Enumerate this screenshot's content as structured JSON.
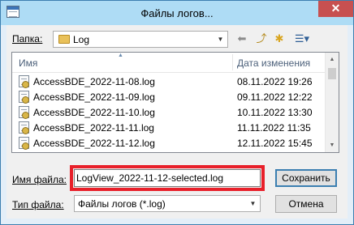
{
  "window": {
    "title": "Файлы логов...",
    "close_glyph": "✕"
  },
  "folder": {
    "label": "Папка:",
    "value": "Log"
  },
  "toolbar": {
    "back_glyph": "⬅",
    "up_glyph": "⤴",
    "new_folder_glyph": "✱",
    "view_glyph": "☰▾"
  },
  "file_list": {
    "columns": [
      "Имя",
      "Дата изменения"
    ],
    "sort_glyph": "▲",
    "rows": [
      {
        "name": "AccessBDE_2022-11-08.log",
        "date": "08.11.2022 19:26"
      },
      {
        "name": "AccessBDE_2022-11-09.log",
        "date": "09.11.2022 12:22"
      },
      {
        "name": "AccessBDE_2022-11-10.log",
        "date": "10.11.2022 13:30"
      },
      {
        "name": "AccessBDE_2022-11-11.log",
        "date": "11.11.2022 11:35"
      },
      {
        "name": "AccessBDE_2022-11-12.log",
        "date": "12.11.2022 15:45"
      }
    ],
    "scroll_up_glyph": "▲",
    "scroll_down_glyph": "▼"
  },
  "filename": {
    "label": "Имя файла:",
    "value": "LogView_2022-11-12-selected.log"
  },
  "filetype": {
    "label": "Тип файла:",
    "value": "Файлы логов (*.log)"
  },
  "buttons": {
    "save": "Сохранить",
    "cancel": "Отмена"
  },
  "colors": {
    "highlight": "#e8202a",
    "close_button": "#c75050",
    "title_bar": "#aedcf5"
  }
}
